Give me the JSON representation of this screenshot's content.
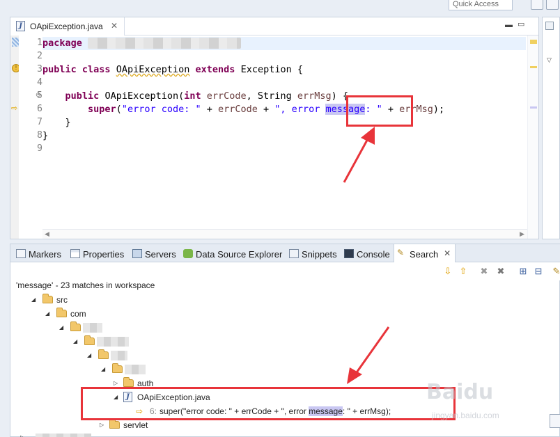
{
  "app": {
    "quick_access": "Quick Access"
  },
  "editor": {
    "tab_title": "OApiException.java",
    "line_numbers": [
      "1",
      "2",
      "3",
      "4",
      "5",
      "6",
      "7",
      "8",
      "9"
    ],
    "code": {
      "l1_kw": "package",
      "l3_kw1": "public",
      "l3_kw2": "class",
      "l3_name": "OApiException",
      "l3_kw3": "extends",
      "l3_parent": "Exception {",
      "l5_kw": "public",
      "l5_ctor": "OApiException(",
      "l5_kw2": "int",
      "l5_var1": "errCode",
      "l5_mid": ", String ",
      "l5_var2": "errMsg",
      "l5_end": ") {",
      "l6_kw": "super",
      "l6_open": "(",
      "l6_str1": "\"error code: \"",
      "l6_plus1": " + ",
      "l6_var1": "errCode",
      "l6_plus2": " + ",
      "l6_str2a": "\", error ",
      "l6_str2b": "message",
      "l6_str2c": ": \"",
      "l6_plus3": " + ",
      "l6_var2": "errMsg",
      "l6_end": ");",
      "l7": "}",
      "l8": "}"
    }
  },
  "bottom": {
    "tabs": [
      {
        "label": "Markers"
      },
      {
        "label": "Properties"
      },
      {
        "label": "Servers"
      },
      {
        "label": "Data Source Explorer"
      },
      {
        "label": "Snippets"
      },
      {
        "label": "Console"
      },
      {
        "label": "Search"
      }
    ],
    "summary": "'message' - 23 matches in workspace",
    "tree": {
      "src": "src",
      "com": "com",
      "auth": "auth",
      "file": "OApiException.java",
      "match_line": "6:",
      "match_pre": " super(\"error code: \" + errCode + \", error ",
      "match_hit": "message",
      "match_post": ": \" + errMsg);",
      "servlet": "servlet"
    }
  },
  "watermark": {
    "text": "Baidu",
    "sub": "jingyan.baidu.com"
  },
  "colors": {
    "highlight_red": "#e8343a",
    "keyword": "#7f0055",
    "string": "#2a00ff",
    "selection": "#c9c7f2"
  }
}
